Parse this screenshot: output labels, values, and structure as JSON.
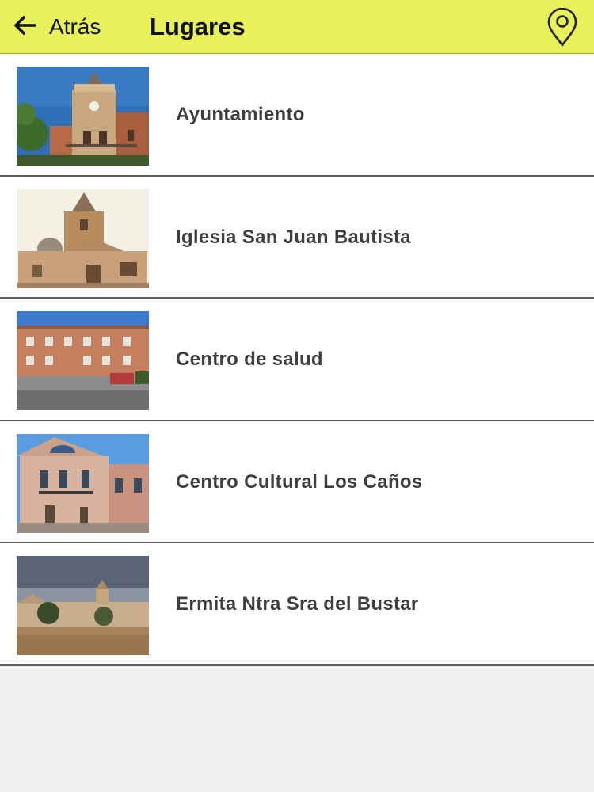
{
  "header": {
    "back_label": "Atrás",
    "title": "Lugares",
    "back_icon": "arrow-left-icon",
    "map_icon": "map-pin-icon",
    "background_color": "#e8f05a"
  },
  "places": [
    {
      "label": "Ayuntamiento",
      "image": "town-hall-photo"
    },
    {
      "label": "Iglesia San Juan Bautista",
      "image": "church-photo"
    },
    {
      "label": "Centro de salud",
      "image": "health-center-photo"
    },
    {
      "label": "Centro Cultural Los Caños",
      "image": "cultural-center-photo"
    },
    {
      "label": "Ermita Ntra Sra del Bustar",
      "image": "hermitage-photo"
    }
  ]
}
